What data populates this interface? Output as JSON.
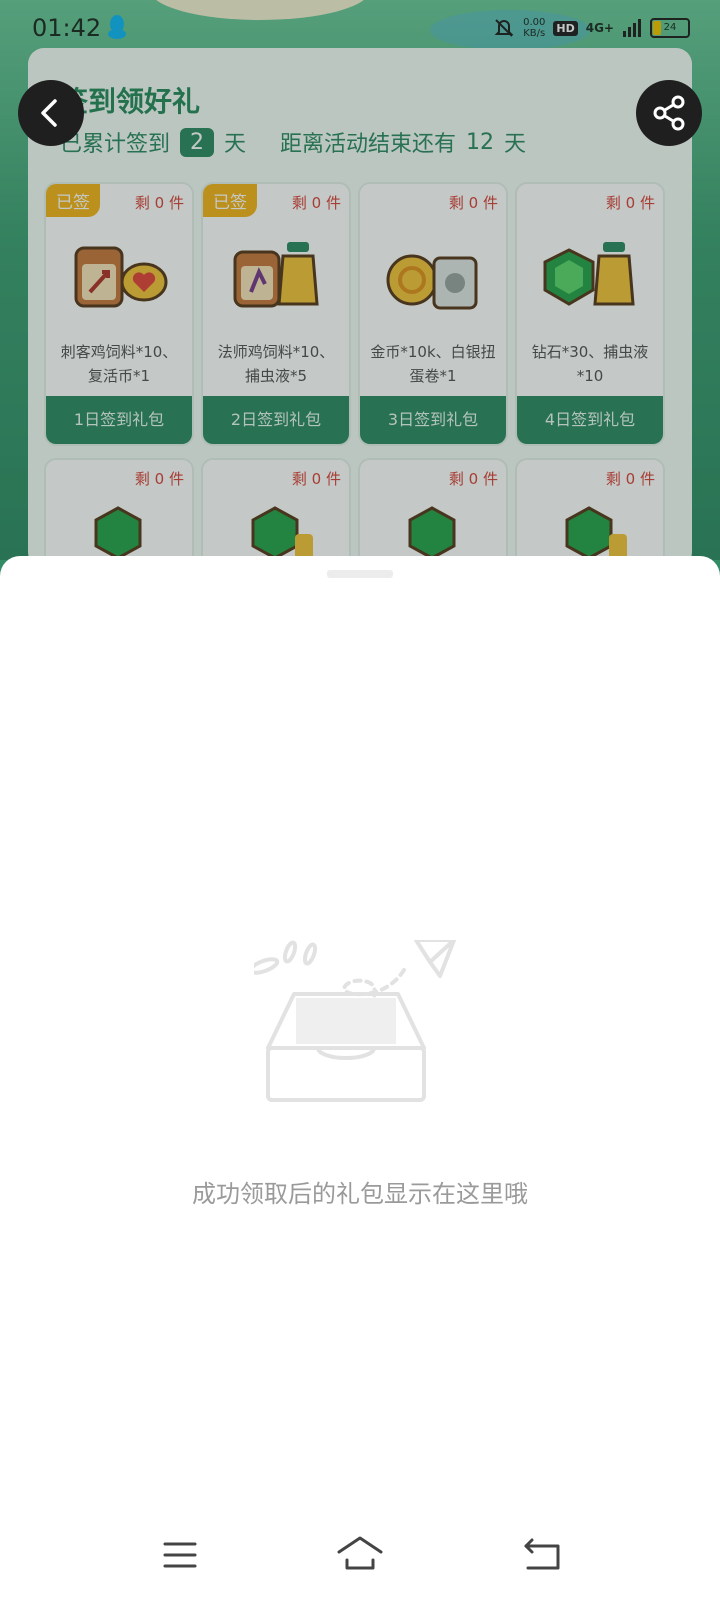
{
  "status_bar": {
    "time": "01:42",
    "net_rate": "0.00",
    "net_unit": "KB/s",
    "hd": "HD",
    "network": "4G+",
    "battery": "24"
  },
  "page": {
    "title": "签到领好礼",
    "cumulative_prefix": "已累计签到",
    "cumulative_days": "2",
    "day_unit": "天",
    "ends_prefix": "距离活动结束还有",
    "ends_days": "12",
    "ends_unit": "天"
  },
  "gifts": [
    {
      "tag": "已签",
      "remain": "剩 0 件",
      "desc": "刺客鸡饲料*10、复活币*1",
      "button": "1日签到礼包"
    },
    {
      "tag": "已签",
      "remain": "剩 0 件",
      "desc": "法师鸡饲料*10、捕虫液*5",
      "button": "2日签到礼包"
    },
    {
      "tag": "",
      "remain": "剩 0 件",
      "desc": "金币*10k、白银扭蛋卷*1",
      "button": "3日签到礼包"
    },
    {
      "tag": "",
      "remain": "剩 0 件",
      "desc": "钻石*30、捕虫液*10",
      "button": "4日签到礼包"
    },
    {
      "tag": "",
      "remain": "剩 0 件",
      "desc": "",
      "button": ""
    },
    {
      "tag": "",
      "remain": "剩 0 件",
      "desc": "",
      "button": ""
    },
    {
      "tag": "",
      "remain": "剩 0 件",
      "desc": "",
      "button": ""
    },
    {
      "tag": "",
      "remain": "剩 0 件",
      "desc": "",
      "button": ""
    }
  ],
  "sheet": {
    "empty_text": "成功领取后的礼包显示在这里哦"
  },
  "colors": {
    "accent_green": "#2f8a64",
    "tag_orange": "#f5b31c",
    "remain_red": "#d9443b"
  },
  "icons": {
    "back": "chevron-left-icon",
    "share": "share-icon",
    "menu": "menu-icon",
    "home": "home-icon",
    "return": "return-icon"
  }
}
